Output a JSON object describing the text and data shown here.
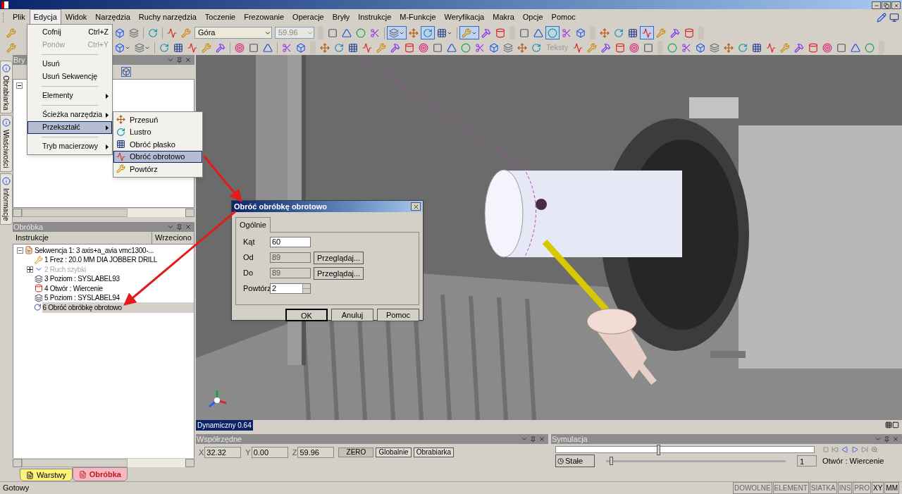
{
  "menu_bar": [
    {
      "label": "Plik",
      "selected": false
    },
    {
      "label": "Edycja",
      "selected": true
    },
    {
      "label": "Widok",
      "selected": false
    },
    {
      "label": "Narzędzia",
      "selected": false
    },
    {
      "label": "Ruchy narzędzia",
      "selected": false
    },
    {
      "label": "Toczenie",
      "selected": false
    },
    {
      "label": "Frezowanie",
      "selected": false
    },
    {
      "label": "Operacje",
      "selected": false
    },
    {
      "label": "Bryły",
      "selected": false
    },
    {
      "label": "Instrukcje",
      "selected": false
    },
    {
      "label": "M-Funkcje",
      "selected": false
    },
    {
      "label": "Weryfikacja",
      "selected": false
    },
    {
      "label": "Makra",
      "selected": false
    },
    {
      "label": "Opcje",
      "selected": false
    },
    {
      "label": "Pomoc",
      "selected": false
    }
  ],
  "edit_menu": [
    {
      "kind": "item",
      "label": "Cofnij",
      "shortcut": "Ctrl+Z",
      "disabled": false,
      "selected": false
    },
    {
      "kind": "item",
      "label": "Ponów",
      "shortcut": "Ctrl+Y",
      "disabled": true,
      "selected": false
    },
    {
      "kind": "separator"
    },
    {
      "kind": "item",
      "label": "Usuń",
      "disabled": false,
      "selected": false
    },
    {
      "kind": "item",
      "label": "Usuń Sekwencję",
      "disabled": false,
      "selected": false
    },
    {
      "kind": "separator"
    },
    {
      "kind": "submenu",
      "label": "Elementy",
      "disabled": false,
      "selected": false
    },
    {
      "kind": "separator"
    },
    {
      "kind": "submenu",
      "label": "Ścieżka narzędzia",
      "disabled": false,
      "selected": false
    },
    {
      "kind": "submenu",
      "label": "Przekształć",
      "disabled": false,
      "selected": true
    },
    {
      "kind": "separator"
    },
    {
      "kind": "submenu",
      "label": "Tryb macierzowy",
      "disabled": false,
      "selected": false
    }
  ],
  "transform_submenu": [
    {
      "label": "Przesuń",
      "selected": false
    },
    {
      "label": "Lustro",
      "selected": false
    },
    {
      "label": "Obróć płasko",
      "selected": false
    },
    {
      "label": "Obróć obrotowo",
      "selected": true
    },
    {
      "label": "Powtórz",
      "selected": false
    }
  ],
  "toolbar_rows": [
    {
      "before_menu": [
        {
          "kind": "button",
          "pressed": false,
          "dropdown": false
        }
      ],
      "items": [
        {
          "kind": "button",
          "pressed": false,
          "dropdown": false
        },
        {
          "kind": "button",
          "pressed": false,
          "dropdown": false
        },
        {
          "kind": "separator"
        },
        {
          "kind": "button",
          "pressed": false,
          "dropdown": false
        },
        {
          "kind": "separator"
        },
        {
          "kind": "button",
          "pressed": false,
          "dropdown": false
        },
        {
          "kind": "button",
          "pressed": false,
          "dropdown": false
        },
        {
          "kind": "combo",
          "value": "Góra",
          "disabled": false
        },
        {
          "kind": "combo",
          "value": "59.96",
          "disabled": true
        },
        {
          "kind": "grip"
        },
        {
          "kind": "button",
          "pressed": false,
          "dropdown": false
        },
        {
          "kind": "button",
          "pressed": false,
          "dropdown": false
        },
        {
          "kind": "button",
          "pressed": false,
          "dropdown": false
        },
        {
          "kind": "button",
          "pressed": false,
          "dropdown": false
        },
        {
          "kind": "separator"
        },
        {
          "kind": "button",
          "pressed": true,
          "dropdown": true
        },
        {
          "kind": "button",
          "pressed": false,
          "dropdown": false
        },
        {
          "kind": "button",
          "pressed": true,
          "dropdown": false
        },
        {
          "kind": "button",
          "pressed": false,
          "dropdown": true
        },
        {
          "kind": "separator"
        },
        {
          "kind": "button",
          "pressed": true,
          "dropdown": true
        },
        {
          "kind": "button",
          "pressed": false,
          "dropdown": false
        },
        {
          "kind": "button",
          "pressed": false,
          "dropdown": false
        },
        {
          "kind": "grip"
        },
        {
          "kind": "button",
          "pressed": false,
          "dropdown": false
        },
        {
          "kind": "button",
          "pressed": false,
          "dropdown": false
        },
        {
          "kind": "button",
          "pressed": true,
          "dropdown": false
        },
        {
          "kind": "button",
          "pressed": false,
          "dropdown": false
        },
        {
          "kind": "button",
          "pressed": false,
          "dropdown": false
        },
        {
          "kind": "grip"
        },
        {
          "kind": "button",
          "pressed": false,
          "dropdown": false
        },
        {
          "kind": "button",
          "pressed": false,
          "dropdown": false
        },
        {
          "kind": "button",
          "pressed": false,
          "dropdown": false
        },
        {
          "kind": "button",
          "pressed": true,
          "dropdown": false
        },
        {
          "kind": "button",
          "pressed": false,
          "dropdown": false
        },
        {
          "kind": "button",
          "pressed": false,
          "dropdown": false
        },
        {
          "kind": "button",
          "pressed": false,
          "dropdown": false
        },
        {
          "kind": "grip"
        }
      ]
    },
    {
      "before_menu": [
        {
          "kind": "button",
          "pressed": false,
          "dropdown": false
        }
      ],
      "items": [
        {
          "kind": "button",
          "pressed": false,
          "dropdown": true
        },
        {
          "kind": "button",
          "pressed": false,
          "dropdown": true
        },
        {
          "kind": "separator"
        },
        {
          "kind": "button",
          "pressed": false,
          "dropdown": false
        },
        {
          "kind": "button",
          "pressed": false,
          "dropdown": false
        },
        {
          "kind": "button",
          "pressed": false,
          "dropdown": false
        },
        {
          "kind": "button",
          "pressed": false,
          "dropdown": false
        },
        {
          "kind": "button",
          "pressed": false,
          "dropdown": false
        },
        {
          "kind": "separator"
        },
        {
          "kind": "button",
          "pressed": false,
          "dropdown": false
        },
        {
          "kind": "button",
          "pressed": false,
          "dropdown": false
        },
        {
          "kind": "button",
          "pressed": false,
          "dropdown": false
        },
        {
          "kind": "separator"
        },
        {
          "kind": "button",
          "pressed": false,
          "dropdown": false
        },
        {
          "kind": "button",
          "pressed": false,
          "dropdown": false
        },
        {
          "kind": "grip"
        },
        {
          "kind": "button",
          "pressed": false,
          "dropdown": false
        },
        {
          "kind": "button",
          "pressed": false,
          "dropdown": false
        },
        {
          "kind": "button",
          "pressed": false,
          "dropdown": false
        },
        {
          "kind": "button",
          "pressed": false,
          "dropdown": false
        },
        {
          "kind": "button",
          "pressed": false,
          "dropdown": false
        },
        {
          "kind": "button",
          "pressed": false,
          "dropdown": false
        },
        {
          "kind": "button",
          "pressed": false,
          "dropdown": false
        },
        {
          "kind": "button",
          "pressed": false,
          "dropdown": false
        },
        {
          "kind": "button",
          "pressed": false,
          "dropdown": false
        },
        {
          "kind": "button",
          "pressed": false,
          "dropdown": false
        },
        {
          "kind": "button",
          "pressed": false,
          "dropdown": false
        },
        {
          "kind": "button",
          "pressed": false,
          "dropdown": false
        },
        {
          "kind": "button",
          "pressed": false,
          "dropdown": false
        },
        {
          "kind": "button",
          "pressed": false,
          "dropdown": false
        },
        {
          "kind": "button",
          "pressed": false,
          "dropdown": false
        },
        {
          "kind": "button",
          "pressed": false,
          "dropdown": false
        },
        {
          "kind": "label",
          "text": "Teksty"
        },
        {
          "kind": "button",
          "pressed": false,
          "dropdown": false
        },
        {
          "kind": "button",
          "pressed": false,
          "dropdown": false
        },
        {
          "kind": "button",
          "pressed": false,
          "dropdown": false
        },
        {
          "kind": "button",
          "pressed": false,
          "dropdown": false
        },
        {
          "kind": "button",
          "pressed": false,
          "dropdown": false
        },
        {
          "kind": "button",
          "pressed": false,
          "dropdown": false
        },
        {
          "kind": "grip"
        },
        {
          "kind": "button",
          "pressed": false,
          "dropdown": false
        },
        {
          "kind": "button",
          "pressed": false,
          "dropdown": false
        },
        {
          "kind": "button",
          "pressed": false,
          "dropdown": false
        },
        {
          "kind": "button",
          "pressed": false,
          "dropdown": false
        },
        {
          "kind": "button",
          "pressed": false,
          "dropdown": false
        },
        {
          "kind": "button",
          "pressed": false,
          "dropdown": false
        },
        {
          "kind": "button",
          "pressed": false,
          "dropdown": false
        },
        {
          "kind": "button",
          "pressed": false,
          "dropdown": false
        },
        {
          "kind": "button",
          "pressed": false,
          "dropdown": false
        },
        {
          "kind": "button",
          "pressed": false,
          "dropdown": false
        },
        {
          "kind": "button",
          "pressed": false,
          "dropdown": false
        },
        {
          "kind": "button",
          "pressed": false,
          "dropdown": false
        },
        {
          "kind": "button",
          "pressed": false,
          "dropdown": false
        },
        {
          "kind": "button",
          "pressed": false,
          "dropdown": false
        },
        {
          "kind": "button",
          "pressed": false,
          "dropdown": false
        },
        {
          "kind": "grip"
        }
      ]
    }
  ],
  "side_tabs": [
    {
      "label": "Obrabiarka"
    },
    {
      "label": "Właściwości"
    },
    {
      "label": "Informacje"
    }
  ],
  "solids_panel": {
    "title": "Bry"
  },
  "machining_panel": {
    "title": "Obróbka",
    "columns": [
      "Instrukcje",
      "Wrzeciono"
    ],
    "tree": [
      {
        "kind": "sequence",
        "label": "Sekwencja 1: 3 axis+a_avia vmc1300-...",
        "expanded": true,
        "disabled": false,
        "selected": false,
        "children": [
          {
            "kind": "tool",
            "label": "1 Frez : 20.0 MM DIA JOBBER DRILL",
            "disabled": false,
            "selected": false
          },
          {
            "kind": "rapid",
            "label": "2 Ruch szybki",
            "expanded": false,
            "disabled": true,
            "selected": false
          },
          {
            "kind": "level",
            "label": "3 Poziom : SYSLABEL93",
            "disabled": false,
            "selected": false
          },
          {
            "kind": "hole",
            "label": "4 Otwór : Wiercenie",
            "disabled": false,
            "selected": false
          },
          {
            "kind": "level",
            "label": "5 Poziom : SYSLABEL94",
            "disabled": false,
            "selected": false
          },
          {
            "kind": "transform",
            "label": "6 Obróć obróbkę obrotowo",
            "disabled": false,
            "selected": true
          }
        ]
      }
    ]
  },
  "bottom_tabs": [
    {
      "label": "Warstwy",
      "selected": false,
      "color": "#fff27a"
    },
    {
      "label": "Obróbka",
      "selected": true,
      "color": "#f7b8c4"
    }
  ],
  "dialog": {
    "title": "Obróć obróbkę obrotowo",
    "tab": {
      "label": "Ogólnie",
      "selected": true
    },
    "fields": [
      {
        "kind": "text",
        "label": "Kąt",
        "value": "60",
        "readonly": false
      },
      {
        "kind": "browse",
        "label": "Od",
        "value": "89",
        "readonly": true,
        "button": "Przeglądaj..."
      },
      {
        "kind": "browse",
        "label": "Do",
        "value": "89",
        "readonly": true,
        "button": "Przeglądaj..."
      },
      {
        "kind": "spin",
        "label": "Powtórz",
        "value": "2",
        "readonly": false
      }
    ],
    "buttons": [
      {
        "label": "OK",
        "default": true
      },
      {
        "label": "Anuluj",
        "default": false
      },
      {
        "label": "Pomoc",
        "default": false
      }
    ]
  },
  "view_mode": "Dynamiczny 0.64",
  "coordinates_panel": {
    "title": "Współrzędne",
    "fields": [
      {
        "label": "X",
        "value": "32.32"
      },
      {
        "label": "Y",
        "value": "0.00"
      },
      {
        "label": "Z",
        "value": "59.96"
      }
    ],
    "buttons": [
      {
        "label": "ZERO",
        "pressed": true
      },
      {
        "label": "Globalnie",
        "pressed": false
      },
      {
        "label": "Obrabiarka",
        "pressed": false
      }
    ]
  },
  "simulation_panel": {
    "title": "Symulacja",
    "position": {
      "level": 0.39
    },
    "speed": {
      "level": 0.02
    },
    "speed_button": "Stałe",
    "step": "1",
    "status": "Otwór : Wiercenie"
  },
  "status_bar": {
    "text": "Gotowy",
    "indicators": [
      {
        "label": "DOWOLNE",
        "active": false
      },
      {
        "label": "ELEMENT",
        "active": false
      },
      {
        "label": "SIATKA",
        "active": false
      },
      {
        "label": "INS",
        "active": false
      },
      {
        "label": "PRO",
        "active": false
      },
      {
        "label": "XY",
        "active": true
      },
      {
        "label": "MM",
        "active": true
      }
    ]
  }
}
